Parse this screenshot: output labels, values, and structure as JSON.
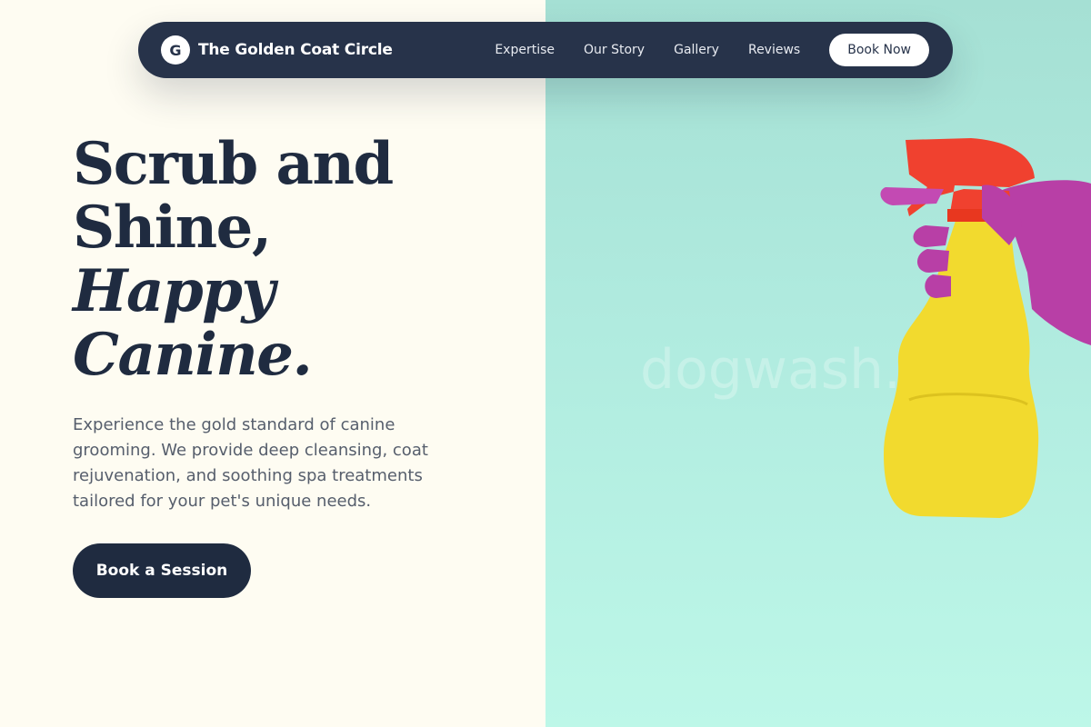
{
  "brand": {
    "logo_letter": "G",
    "name": "The Golden Coat Circle"
  },
  "nav": {
    "links": [
      "Expertise",
      "Our Story",
      "Gallery",
      "Reviews"
    ],
    "cta": "Book Now"
  },
  "hero": {
    "title_line1": "Scrub and",
    "title_line2": "Shine,",
    "title_line3": "Happy",
    "title_line4": "Canine.",
    "description": "Experience the gold standard of canine grooming. We provide deep cleansing, coat rejuvenation, and soothing spa treatments tailored for your pet's unique needs.",
    "cta": "Book a Session"
  },
  "image": {
    "watermark": "dogwash.site"
  },
  "colors": {
    "navy": "#27334a",
    "cream": "#fefcf2",
    "mint": "#b0ebdf",
    "bottle_yellow": "#f2da2e",
    "nozzle_red": "#f0412f",
    "glove_magenta": "#b83fa6"
  },
  "icons": [
    "logo-badge",
    "spray-bottle-photo"
  ]
}
